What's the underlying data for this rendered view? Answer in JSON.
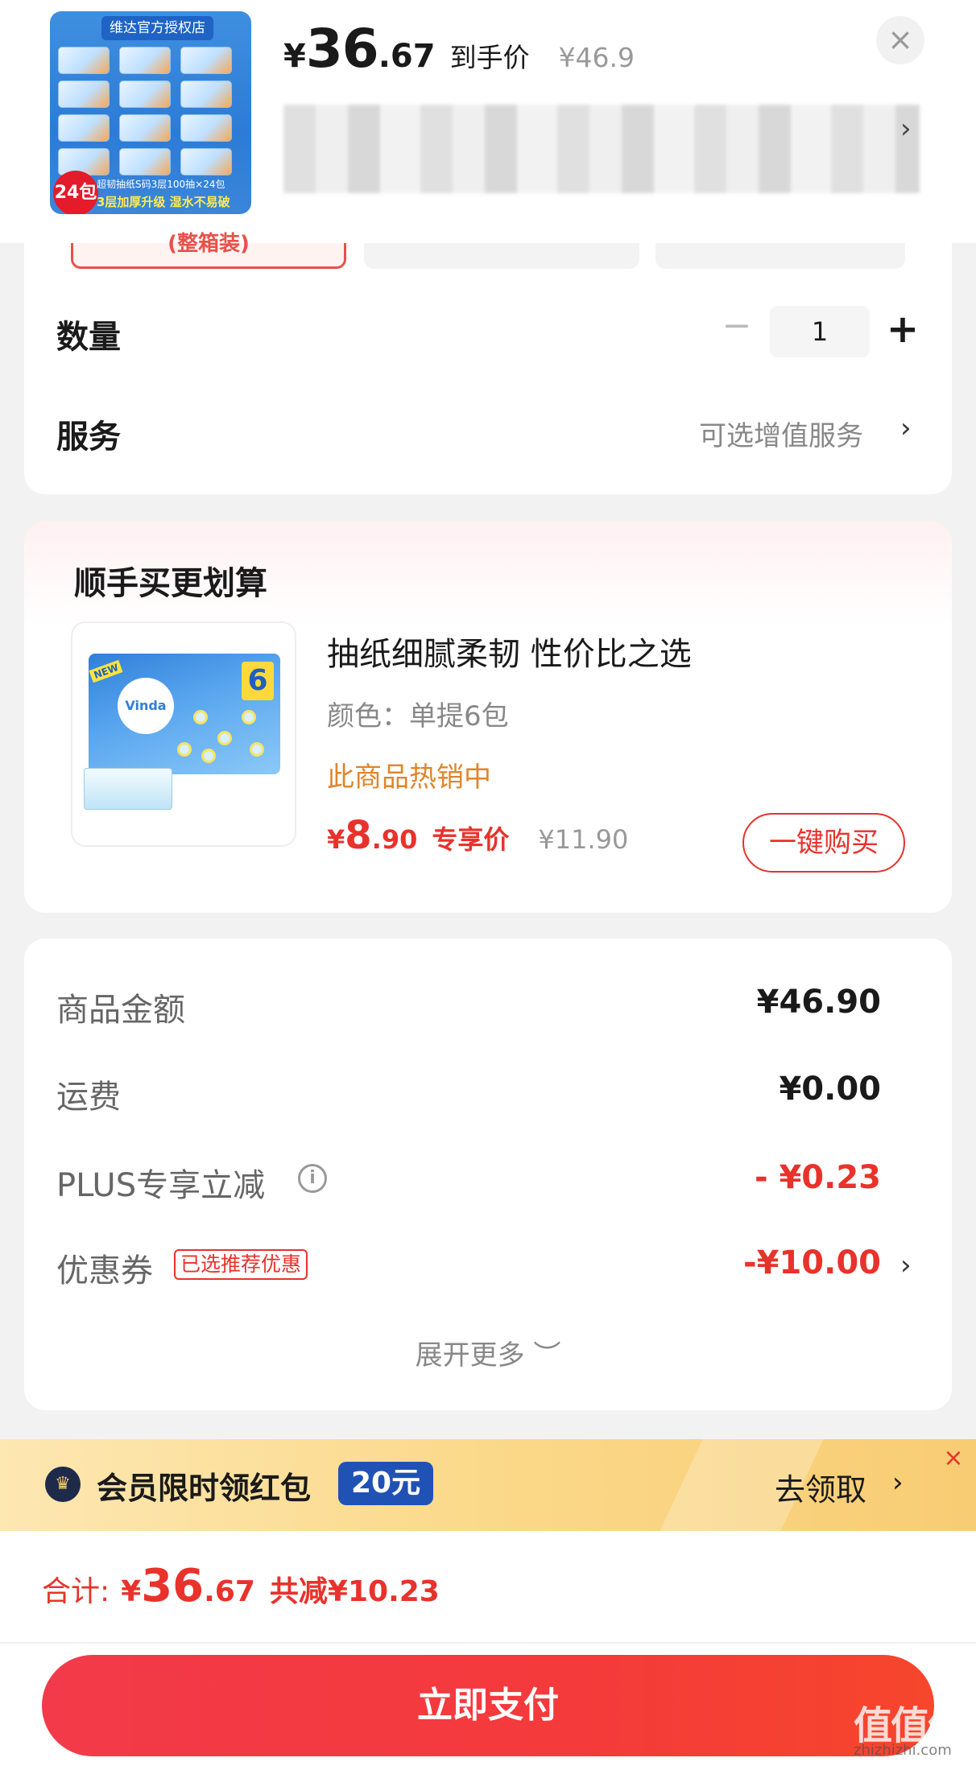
{
  "header": {
    "thumb_shop": "维达官方授权店",
    "thumb_badge": "24包",
    "thumb_caption": "超韧抽纸S码3层100抽×24包",
    "thumb_caption2": "3层加厚升级 湿水不易破",
    "price_yen": "¥",
    "price_int": "36",
    "price_dec": ".67",
    "price_label": "到手价",
    "price_original": "¥46.9",
    "close_symbol": "×",
    "address_chevron": "›"
  },
  "spec": {
    "tab1_label": "(整箱装)"
  },
  "quantity": {
    "label": "数量",
    "minus": "−",
    "value": "1",
    "plus": "+"
  },
  "service": {
    "label": "服务",
    "value": "可选增值服务",
    "chevron": "›"
  },
  "addon": {
    "title": "顺手买更划算",
    "logo": "Vinda",
    "six": "6",
    "new": "NEW",
    "name": "抽纸细腻柔韧 性价比之选",
    "spec": "颜色：单提6包",
    "hot": "此商品热销中",
    "price_yen": "¥",
    "price_int": "8",
    "price_dec": ".90",
    "price_label": "专享价",
    "price_original": "¥11.90",
    "buy_label": "一键购买"
  },
  "summary": {
    "rows": [
      {
        "label": "商品金额",
        "value": "¥46.90"
      },
      {
        "label": "运费",
        "value": "¥0.00"
      },
      {
        "label": "PLUS专享立减",
        "value": "- ¥0.23"
      },
      {
        "label": "优惠券",
        "value": "-¥10.00"
      }
    ],
    "info_symbol": "i",
    "coupon_tag": "已选推荐优惠",
    "coupon_chevron": "›",
    "expand_label": "展开更多 ︶"
  },
  "member": {
    "icon": "♛",
    "text": "会员限时领红包",
    "badge": "20元",
    "go_label": "去领取",
    "chevron": "›",
    "close": "×"
  },
  "bottom": {
    "total_label": "合计:",
    "total_yen": "¥",
    "total_int": "36",
    "total_dec": ".67",
    "saved": "共减¥10.23",
    "pay_label": "立即支付",
    "watermark": "值值值",
    "watermark_sub": "zhizhizhi.com"
  },
  "colors": {
    "accent_red": "#e8322b",
    "hot_orange": "#e0852a",
    "member_blue": "#2052b6"
  }
}
